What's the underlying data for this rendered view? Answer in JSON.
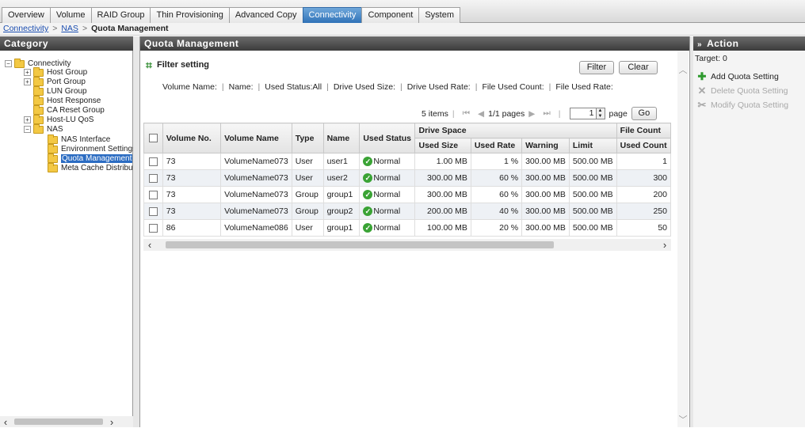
{
  "tabs": [
    "Overview",
    "Volume",
    "RAID Group",
    "Thin Provisioning",
    "Advanced Copy",
    "Connectivity",
    "Component",
    "System"
  ],
  "active_tab": "Connectivity",
  "breadcrumb": {
    "item1": "Connectivity",
    "item2": "NAS",
    "sep": ">",
    "current": "Quota Management"
  },
  "category": {
    "title": "Category",
    "nodes": [
      {
        "label": "Connectivity",
        "expander": "−"
      },
      {
        "label": "Host Group",
        "expander": "+"
      },
      {
        "label": "Port Group",
        "expander": "+"
      },
      {
        "label": "LUN Group"
      },
      {
        "label": "Host Response"
      },
      {
        "label": "CA Reset Group"
      },
      {
        "label": "Host-LU QoS",
        "expander": "+"
      },
      {
        "label": "NAS",
        "expander": "−"
      },
      {
        "label": "NAS Interface"
      },
      {
        "label": "Environment Settings"
      },
      {
        "label": "Quota Management"
      },
      {
        "label": "Meta Cache Distribution"
      }
    ]
  },
  "main": {
    "title": "Quota Management",
    "filter_title": "Filter setting",
    "filter_button": "Filter",
    "clear_button": "Clear",
    "filter_items": [
      "Volume Name:",
      "Name:",
      "Used Status:All",
      "Drive Used Size:",
      "Drive Used Rate:",
      "File Used Count:",
      "File Used Rate:"
    ],
    "pager": {
      "items": "5 items",
      "first": "⏮",
      "prev": "◀",
      "pages": "1/1 pages",
      "next": "▶",
      "last": "⏭",
      "page_value": "1",
      "page_label": "page",
      "go": "Go"
    }
  },
  "table": {
    "headers": {
      "volume_no": "Volume No.",
      "volume_name": "Volume Name",
      "type": "Type",
      "name": "Name",
      "used_status": "Used Status",
      "drive_space": "Drive Space",
      "used_size": "Used Size",
      "used_rate": "Used Rate",
      "warning": "Warning",
      "limit": "Limit",
      "file_count": "File Count",
      "used_count": "Used Count"
    },
    "rows": [
      {
        "volume_no": "73",
        "volume_name": "VolumeName073",
        "type": "User",
        "name": "user1",
        "used_status": "Normal",
        "used_size": "1.00 MB",
        "used_rate": "1 %",
        "warning": "300.00 MB",
        "limit": "500.00 MB",
        "used_count": "1"
      },
      {
        "volume_no": "73",
        "volume_name": "VolumeName073",
        "type": "User",
        "name": "user2",
        "used_status": "Normal",
        "used_size": "300.00 MB",
        "used_rate": "60 %",
        "warning": "300.00 MB",
        "limit": "500.00 MB",
        "used_count": "300"
      },
      {
        "volume_no": "73",
        "volume_name": "VolumeName073",
        "type": "Group",
        "name": "group1",
        "used_status": "Normal",
        "used_size": "300.00 MB",
        "used_rate": "60 %",
        "warning": "300.00 MB",
        "limit": "500.00 MB",
        "used_count": "200"
      },
      {
        "volume_no": "73",
        "volume_name": "VolumeName073",
        "type": "Group",
        "name": "group2",
        "used_status": "Normal",
        "used_size": "200.00 MB",
        "used_rate": "40 %",
        "warning": "300.00 MB",
        "limit": "500.00 MB",
        "used_count": "250"
      },
      {
        "volume_no": "86",
        "volume_name": "VolumeName086",
        "type": "User",
        "name": "group1",
        "used_status": "Normal",
        "used_size": "100.00 MB",
        "used_rate": "20 %",
        "warning": "300.00 MB",
        "limit": "500.00 MB",
        "used_count": "50"
      }
    ]
  },
  "action": {
    "title": "Action",
    "target": "Target: 0",
    "items": [
      {
        "label": "Add Quota Setting",
        "icon": "plus-icon",
        "enabled": true
      },
      {
        "label": "Delete Quota Setting",
        "icon": "delete-x-icon",
        "enabled": false
      },
      {
        "label": "Modify Quota Setting",
        "icon": "modify-icon",
        "enabled": false
      }
    ]
  },
  "colors": {
    "accent": "#2f72b8",
    "header_dark": "#3c3c3c",
    "ok_green": "#3aa335"
  }
}
